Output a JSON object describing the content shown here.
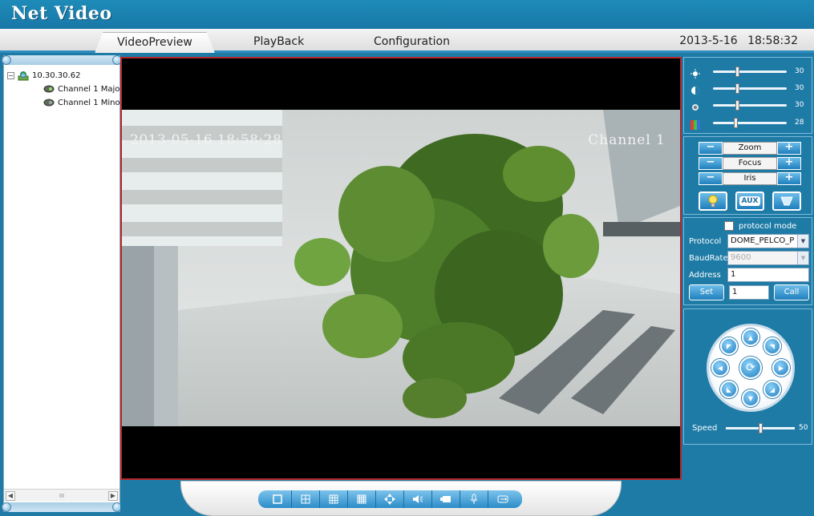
{
  "app": {
    "title": "Net Video"
  },
  "menu": {
    "tabs": [
      {
        "label": "VideoPreview",
        "active": true
      },
      {
        "label": "PlayBack"
      },
      {
        "label": "Configuration"
      }
    ],
    "date": "2013-5-16",
    "time": "18:58:32"
  },
  "tree": {
    "device": "10.30.30.62",
    "channels": [
      "Channel 1 Majo",
      "Channel 1 Minoi"
    ],
    "expand_symbol": "−",
    "scroll_grip": "III"
  },
  "video": {
    "osd_time": "2013-05-16 18:58:28",
    "osd_channel": "Channel 1",
    "border_color": "#b3262b"
  },
  "toolbar": {
    "icons": [
      "single-view-icon",
      "quad-view-icon",
      "nine-view-icon",
      "sixteen-view-icon",
      "ptz-move-icon",
      "audio-icon",
      "fullscreen-icon",
      "microphone-icon",
      "switch-icon"
    ]
  },
  "image_adjust": {
    "sliders": [
      {
        "icon": "brightness-icon",
        "value": 30
      },
      {
        "icon": "contrast-icon",
        "value": 30
      },
      {
        "icon": "saturation-icon",
        "value": 30
      },
      {
        "icon": "hue-icon",
        "value": 28
      }
    ]
  },
  "lens": {
    "rows": [
      {
        "label": "Zoom",
        "minus": "−",
        "plus": "+"
      },
      {
        "label": "Focus",
        "minus": "−",
        "plus": "+"
      },
      {
        "label": "Iris",
        "minus": "−",
        "plus": "+"
      }
    ],
    "aux_label": "AUX"
  },
  "protocol": {
    "mode_label": "protocol mode",
    "protocol_label": "Protocol",
    "protocol_value": "DOME_PELCO_P",
    "baudrate_label": "BaudRate",
    "baudrate_value": "9600",
    "address_label": "Address",
    "address_value": "1",
    "set_label": "Set",
    "preset_value": "1",
    "call_label": "Call"
  },
  "ptz": {
    "speed_label": "Speed",
    "speed_value": 50,
    "speed_fraction": 0.5
  },
  "colors": {
    "accent": "#1e7ba6",
    "button": "#2c8cc8"
  }
}
